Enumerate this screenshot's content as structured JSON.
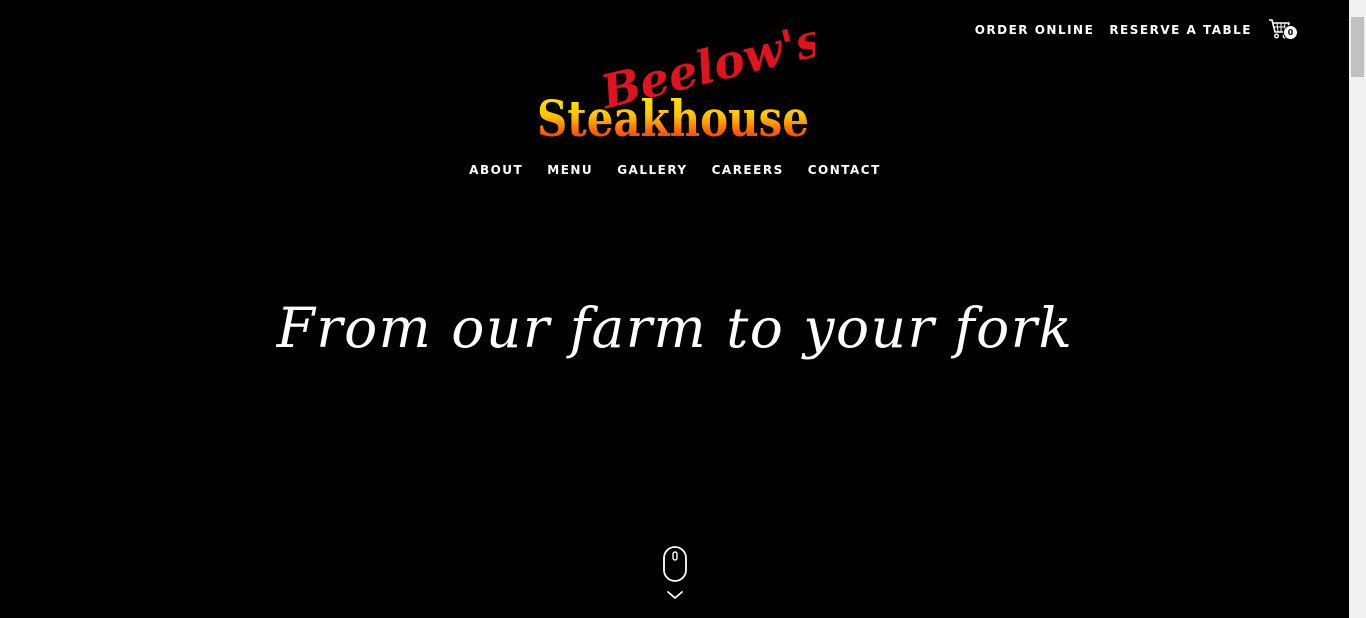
{
  "brand": {
    "script_text": "Beelow's",
    "main_text": "Steakhouse"
  },
  "header": {
    "order_online": "ORDER ONLINE",
    "reserve_table": "RESERVE A TABLE",
    "cart_count": "0",
    "cart_icon": "shopping-cart-icon"
  },
  "nav": {
    "items": [
      {
        "label": "ABOUT"
      },
      {
        "label": "MENU"
      },
      {
        "label": "GALLERY"
      },
      {
        "label": "CAREERS"
      },
      {
        "label": "CONTACT"
      }
    ]
  },
  "hero": {
    "title": "From our farm to your fork",
    "scroll_icon": "mouse-scroll-icon",
    "chevron_icon": "chevron-down-icon"
  },
  "colors": {
    "background": "#000000",
    "text": "#ffffff",
    "logo_red": "#e0141e",
    "logo_yellow": "#ffe600",
    "logo_orange": "#ff7a00"
  }
}
